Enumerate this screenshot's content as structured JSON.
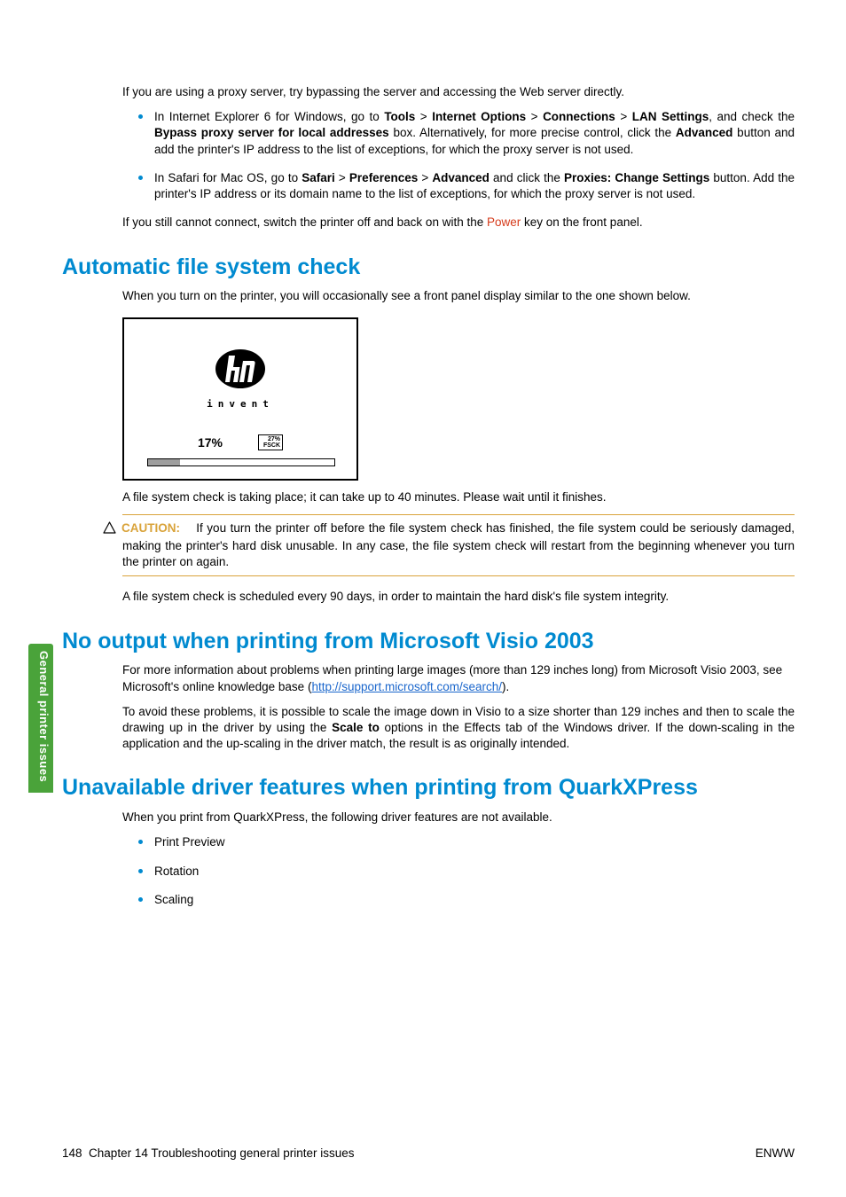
{
  "sideTab": "General printer issues",
  "intro": "If you are using a proxy server, try bypassing the server and accessing the Web server directly.",
  "bullets1": {
    "ie": {
      "pre": "In Internet Explorer 6 for Windows, go to ",
      "b1": "Tools",
      "sep": " > ",
      "b2": "Internet Options",
      "b3": "Connections",
      "b4": "LAN Settings",
      "mid1": ", and check the ",
      "b5": "Bypass proxy server for local addresses",
      "mid2": " box. Alternatively, for more precise control, click the ",
      "b6": "Advanced",
      "tail": " button and add the printer's IP address to the list of exceptions, for which the proxy server is not used."
    },
    "safari": {
      "pre": "In Safari for Mac OS, go to ",
      "b1": "Safari",
      "sep": " > ",
      "b2": "Preferences",
      "b3": "Advanced",
      "mid1": " and click the ",
      "b4": "Proxies: Change Settings",
      "tail": " button. Add the printer's IP address or its domain name to the list of exceptions, for which the proxy server is not used."
    }
  },
  "stillCannot": {
    "pre": "If you still cannot connect, switch the printer off and back on with the ",
    "power": "Power",
    "tail": " key on the front panel."
  },
  "h1a": "Automatic file system check",
  "afsc1": "When you turn on the printer, you will occasionally see a front panel display similar to the one shown below.",
  "panel": {
    "invent": "invent",
    "pct": "17%",
    "badgeTop": "27%",
    "badgeBot": "FSCK"
  },
  "afsc2": "A file system check is taking place; it can take up to 40 minutes. Please wait until it finishes.",
  "caution": {
    "label": "CAUTION:",
    "text": "If you turn the printer off before the file system check has finished, the file system could be seriously damaged, making the printer's hard disk unusable. In any case, the file system check will restart from the beginning whenever you turn the printer on again."
  },
  "afsc3": "A file system check is scheduled every 90 days, in order to maintain the hard disk's file system integrity.",
  "h1b": "No output when printing from Microsoft Visio 2003",
  "visio1": {
    "pre": "For more information about problems when printing large images (more than 129 inches long) from Microsoft Visio 2003, see Microsoft's online knowledge base (",
    "link": "http://support.microsoft.com/search/",
    "tail": ")."
  },
  "visio2": {
    "pre": "To avoid these problems, it is possible to scale the image down in Visio to a size shorter than 129 inches and then to scale the drawing up in the driver by using the ",
    "b1": "Scale to",
    "tail": " options in the Effects tab of the Windows driver. If the down-scaling in the application and the up-scaling in the driver match, the result is as originally intended."
  },
  "h1c": "Unavailable driver features when printing from QuarkXPress",
  "quark1": "When you print from QuarkXPress, the following driver features are not available.",
  "quarkList": [
    "Print Preview",
    "Rotation",
    "Scaling"
  ],
  "footer": {
    "page": "148",
    "chapter": "Chapter 14   Troubleshooting general printer issues",
    "right": "ENWW"
  }
}
